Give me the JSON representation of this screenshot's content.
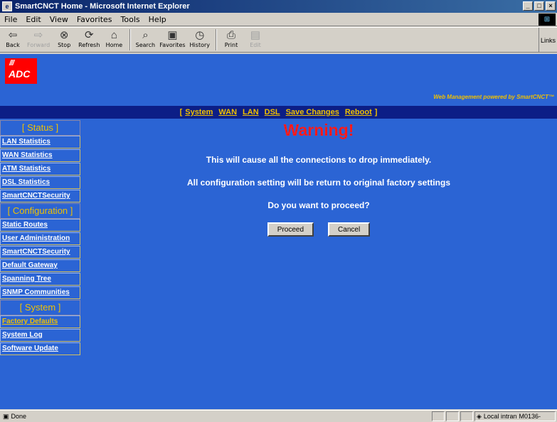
{
  "window": {
    "title": "SmartCNCT Home - Microsoft Internet Explorer"
  },
  "menu": [
    "File",
    "Edit",
    "View",
    "Favorites",
    "Tools",
    "Help"
  ],
  "toolbar": {
    "back": "Back",
    "forward": "Forward",
    "stop": "Stop",
    "refresh": "Refresh",
    "home": "Home",
    "search": "Search",
    "favorites": "Favorites",
    "history": "History",
    "print": "Print",
    "edit": "Edit",
    "links": "Links"
  },
  "page": {
    "logo_text": "ADC",
    "logo_slashes": "///",
    "powered_by": "Web Management powered by SmartCNCT™",
    "nav": {
      "bracket_open": "[",
      "bracket_close": "]",
      "items": [
        "System",
        "WAN",
        "LAN",
        "DSL",
        "Save Changes",
        "Reboot"
      ]
    },
    "sidebar": {
      "status_head": "[ Status ]",
      "status_items": [
        "LAN Statistics",
        "WAN Statistics",
        "ATM Statistics",
        "DSL Statistics",
        "SmartCNCTSecurity"
      ],
      "config_head": "[ Configuration ]",
      "config_items": [
        "Static Routes",
        "User Administration",
        "SmartCNCTSecurity",
        "Default Gateway",
        "Spanning Tree",
        "SNMP Communities"
      ],
      "system_head": "[ System ]",
      "system_items": [
        "Factory Defaults",
        "System Log",
        "Software Update"
      ]
    },
    "main": {
      "title": "Warning!",
      "line1": "This will cause all the connections to drop immediately.",
      "line2": "All configuration setting will be return to original factory settings",
      "line3": "Do you want to proceed?",
      "proceed": "Proceed",
      "cancel": "Cancel"
    }
  },
  "status": {
    "text": "Done",
    "zone": "Local intran",
    "extra": "M0136-"
  },
  "colors": {
    "page_bg": "#2b64d4",
    "nav_bg": "#0c1e86",
    "accent_yellow": "#f0c000",
    "warning_red": "#ff1a1a"
  }
}
